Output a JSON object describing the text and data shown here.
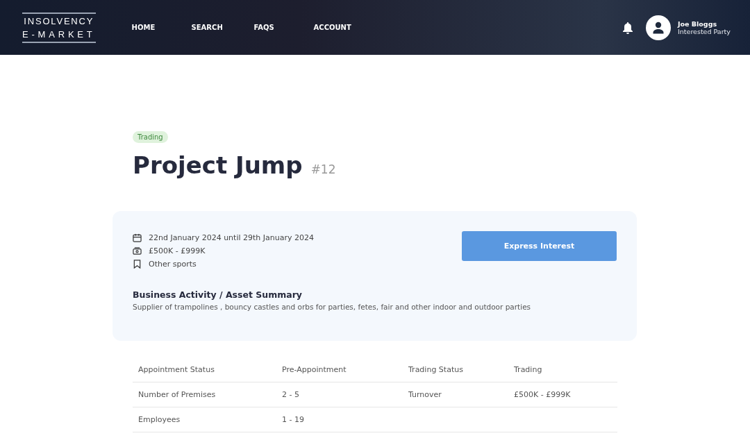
{
  "header": {
    "logo": {
      "line_1": "INSOLVENCY",
      "line_2": "E-MARKET"
    },
    "nav": [
      {
        "label": "HOME"
      },
      {
        "label": "SEARCH"
      },
      {
        "label": "FAQS"
      },
      {
        "label": "ACCOUNT"
      }
    ],
    "user": {
      "name": "Joe Bloggs",
      "role": "Interested Party"
    }
  },
  "listing": {
    "status": "Trading",
    "title": "Project Jump",
    "number": "#12",
    "details": [
      {
        "kind": "date",
        "text": "22nd January 2024 until 29th January 2024"
      },
      {
        "kind": "money",
        "text": "£500K - £999K"
      },
      {
        "kind": "category",
        "text": "Other sports"
      }
    ],
    "action": "Express Interest",
    "summary_heading": "Business Activity / Asset Summary",
    "summary": "Supplier of trampolines , bouncy castles and orbs for parties, fetes, fair and other indoor and outdoor parties"
  },
  "table": {
    "rows": [
      [
        "Appointment Status",
        "Pre-Appointment",
        "Trading Status",
        "Trading"
      ],
      [
        "Number of Premises",
        "2 - 5",
        "Turnover",
        "£500K - £999K"
      ],
      [
        "Employees",
        "1 - 19"
      ]
    ]
  }
}
